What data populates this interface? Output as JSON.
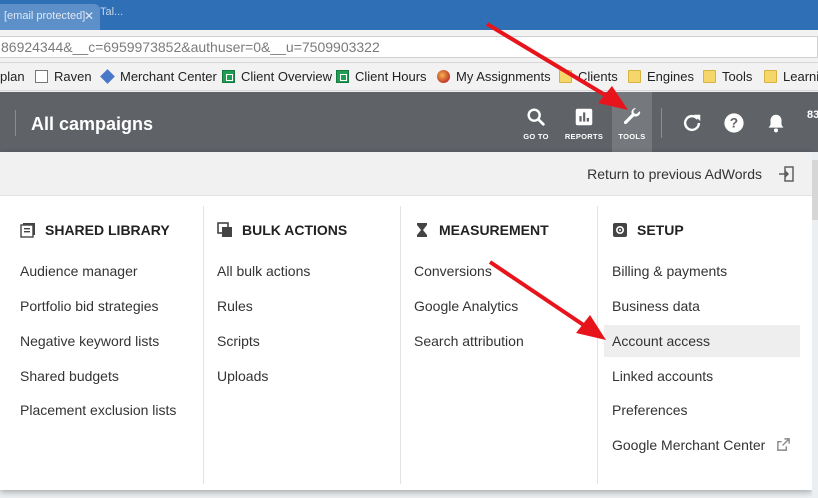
{
  "browser": {
    "tab_title": "[email protected]",
    "tab2_title": "Tal...",
    "url": "86924344&__c=6959973852&authuser=0&__u=7509903322"
  },
  "bookmarks": [
    {
      "label": "plan",
      "icon": "none"
    },
    {
      "label": "Raven",
      "icon": "page-icon"
    },
    {
      "label": "Merchant Center",
      "icon": "merchant-icon"
    },
    {
      "label": "Client Overview",
      "icon": "sheet-icon"
    },
    {
      "label": "Client Hours",
      "icon": "sheet-icon"
    },
    {
      "label": "My Assignments",
      "icon": "ball-icon"
    },
    {
      "label": "Clients",
      "icon": "folder-icon"
    },
    {
      "label": "Engines",
      "icon": "folder-icon"
    },
    {
      "label": "Tools",
      "icon": "folder-icon"
    },
    {
      "label": "Learni",
      "icon": "folder-icon"
    }
  ],
  "header": {
    "title": "All campaigns",
    "goto_label": "GO TO",
    "reports_label": "REPORTS",
    "tools_label": "TOOLS",
    "account_partial": "83"
  },
  "panel": {
    "return_label": "Return to previous AdWords",
    "columns": [
      {
        "title": "SHARED LIBRARY",
        "icon": "library-icon",
        "items": [
          "Audience manager",
          "Portfolio bid strategies",
          "Negative keyword lists",
          "Shared budgets",
          "Placement exclusion lists"
        ]
      },
      {
        "title": "BULK ACTIONS",
        "icon": "copy-icon",
        "items": [
          "All bulk actions",
          "Rules",
          "Scripts",
          "Uploads"
        ]
      },
      {
        "title": "MEASUREMENT",
        "icon": "hourglass-icon",
        "items": [
          "Conversions",
          "Google Analytics",
          "Search attribution"
        ]
      },
      {
        "title": "SETUP",
        "icon": "gear-icon",
        "items": [
          "Billing & payments",
          "Business data",
          "Account access",
          "Linked accounts",
          "Preferences",
          "Google Merchant Center"
        ]
      }
    ],
    "highlighted_item": "Account access"
  },
  "colors": {
    "header_bg": "#5f6368",
    "tabbar_bg": "#2f6fb5",
    "arrow": "#e8141c"
  }
}
